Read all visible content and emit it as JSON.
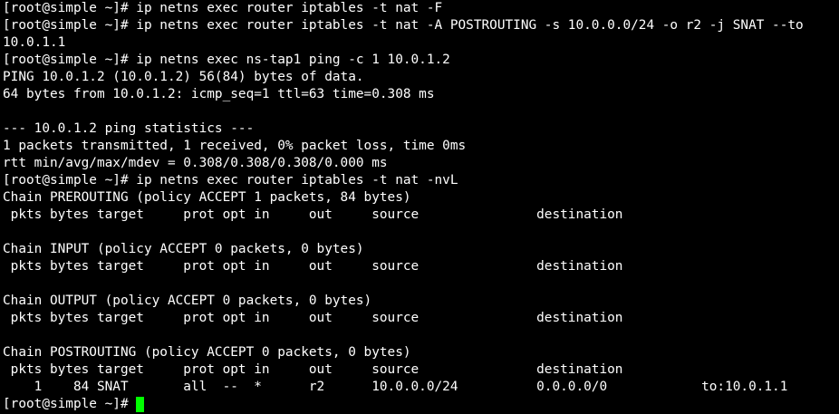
{
  "terminal": {
    "cursor_color": "#00ff00",
    "background_color": "#000000",
    "text_color": "#ffffff",
    "lines": [
      "[root@simple ~]# ip netns exec router iptables -t nat -F",
      "[root@simple ~]# ip netns exec router iptables -t nat -A POSTROUTING -s 10.0.0.0/24 -o r2 -j SNAT --to",
      "10.0.1.1",
      "[root@simple ~]# ip netns exec ns-tap1 ping -c 1 10.0.1.2",
      "PING 10.0.1.2 (10.0.1.2) 56(84) bytes of data.",
      "64 bytes from 10.0.1.2: icmp_seq=1 ttl=63 time=0.308 ms",
      "",
      "--- 10.0.1.2 ping statistics ---",
      "1 packets transmitted, 1 received, 0% packet loss, time 0ms",
      "rtt min/avg/max/mdev = 0.308/0.308/0.308/0.000 ms",
      "[root@simple ~]# ip netns exec router iptables -t nat -nvL",
      "Chain PREROUTING (policy ACCEPT 1 packets, 84 bytes)",
      " pkts bytes target     prot opt in     out     source               destination",
      "",
      "Chain INPUT (policy ACCEPT 0 packets, 0 bytes)",
      " pkts bytes target     prot opt in     out     source               destination",
      "",
      "Chain OUTPUT (policy ACCEPT 0 packets, 0 bytes)",
      " pkts bytes target     prot opt in     out     source               destination",
      "",
      "Chain POSTROUTING (policy ACCEPT 0 packets, 0 bytes)",
      " pkts bytes target     prot opt in     out     source               destination",
      "    1    84 SNAT       all  --  *      r2      10.0.0.0/24          0.0.0.0/0            to:10.0.1.1"
    ],
    "prompt": "[root@simple ~]# "
  }
}
